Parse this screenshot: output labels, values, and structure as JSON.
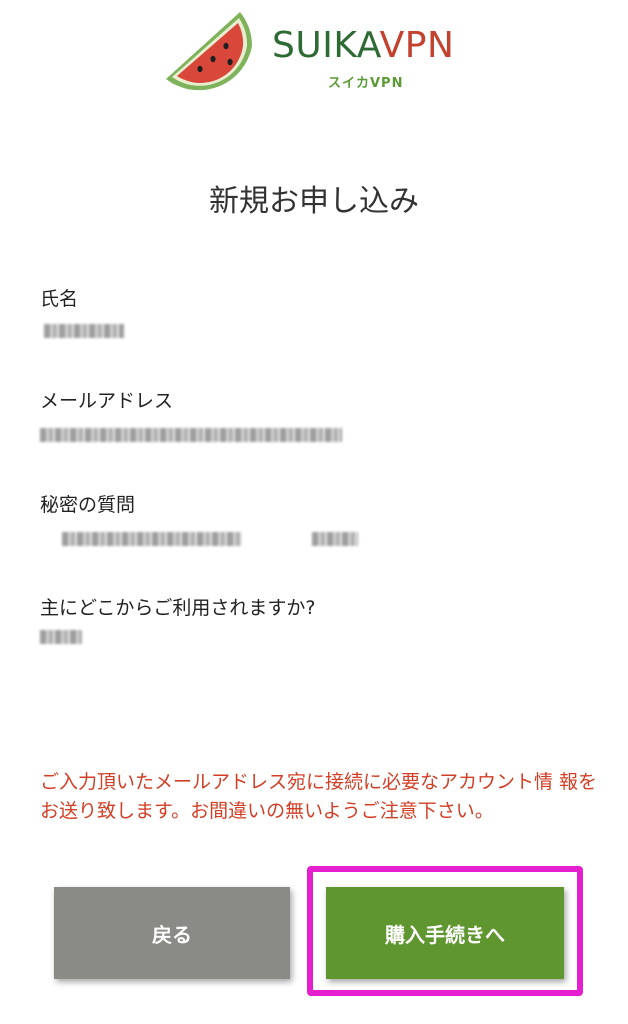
{
  "logo": {
    "brand_part1": "SUIKA",
    "brand_part2": "VPN",
    "subtitle": "スイカVPN",
    "colors": {
      "suika": "#2e6b34",
      "vpn": "#c3412f",
      "melon_flesh": "#d9473a",
      "rind": "#6aa84f"
    }
  },
  "title": "新規お申し込み",
  "fields": [
    {
      "label": "氏名"
    },
    {
      "label": "メールアドレス"
    },
    {
      "label": "秘密の質問"
    },
    {
      "label": "主にどこからご利用されますか?"
    }
  ],
  "notice": "ご入力頂いたメールアドレス宛に接続に必要なアカウント情 報をお送り致します。お間違いの無いようご注意下さい。",
  "buttons": {
    "back_label": "戻る",
    "next_label": "購入手続きへ"
  },
  "colors": {
    "notice": "#d33f26",
    "back_button": "#8a8a86",
    "next_button": "#5f9630",
    "highlight": "#e51fce"
  }
}
